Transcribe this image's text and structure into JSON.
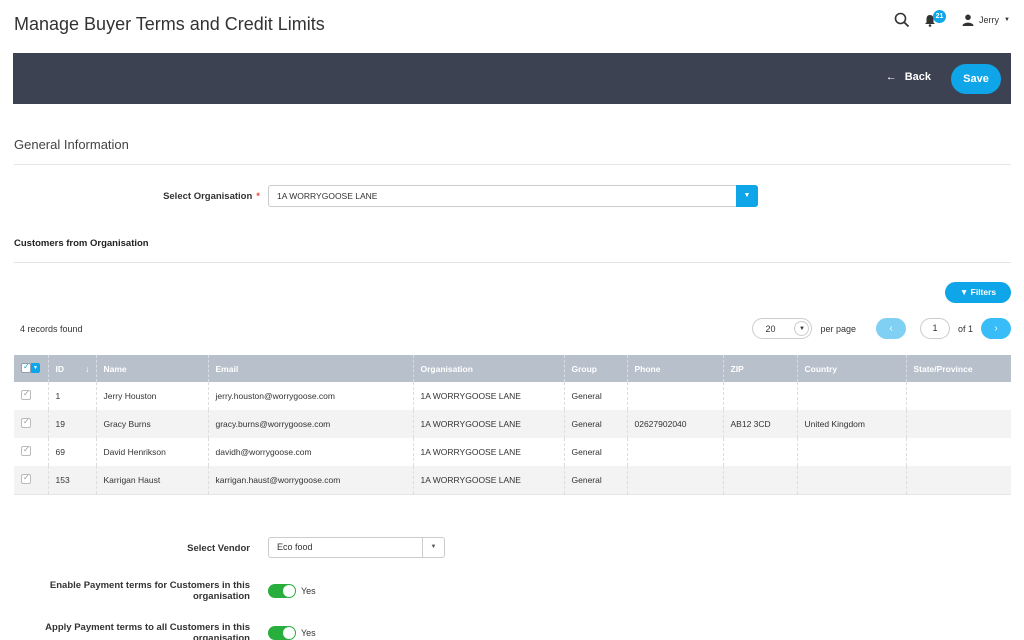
{
  "header": {
    "title": "Manage Buyer Terms and Credit Limits",
    "notification_count": "21",
    "user_name": "Jerry"
  },
  "toolbar": {
    "back_label": "Back",
    "save_label": "Save"
  },
  "general": {
    "title": "General Information",
    "select_org_label": "Select Organisation",
    "required_mark": "*",
    "selected_org": "1A WORRYGOOSE LANE"
  },
  "customers": {
    "title": "Customers from Organisation",
    "filters_label": "Filters",
    "records_found": "4 records found",
    "per_page_value": "20",
    "per_page_label": "per page",
    "page_number": "1",
    "page_of": "of 1",
    "columns": [
      "ID",
      "Name",
      "Email",
      "Organisation",
      "Group",
      "Phone",
      "ZIP",
      "Country",
      "State/Province"
    ],
    "rows": [
      [
        "1",
        "Jerry Houston",
        "jerry.houston@worrygoose.com",
        "1A WORRYGOOSE LANE",
        "General",
        "",
        "",
        "",
        ""
      ],
      [
        "19",
        "Gracy Burns",
        "gracy.burns@worrygoose.com",
        "1A WORRYGOOSE LANE",
        "General",
        "02627902040",
        "AB12 3CD",
        "United Kingdom",
        ""
      ],
      [
        "69",
        "David Henrikson",
        "davidh@worrygoose.com",
        "1A WORRYGOOSE LANE",
        "General",
        "",
        "",
        "",
        ""
      ],
      [
        "153",
        "Karrigan Haust",
        "karrigan.haust@worrygoose.com",
        "1A WORRYGOOSE LANE",
        "General",
        "",
        "",
        "",
        ""
      ]
    ]
  },
  "vendor": {
    "label": "Select Vendor",
    "value": "Eco food"
  },
  "payment_terms": {
    "enable_label_line1": "Enable Payment terms for Customers in this",
    "enable_label_line2": "organisation",
    "enable_value": "Yes",
    "apply_label_line1": "Apply Payment terms to all Customers in this",
    "apply_label_line2": "organisation",
    "apply_value": "Yes"
  },
  "colors": {
    "accent": "#0ea5e9",
    "toolbar_bg": "#3c4252",
    "toggle_on": "#27ae3c",
    "table_header": "#b8c0cc"
  }
}
